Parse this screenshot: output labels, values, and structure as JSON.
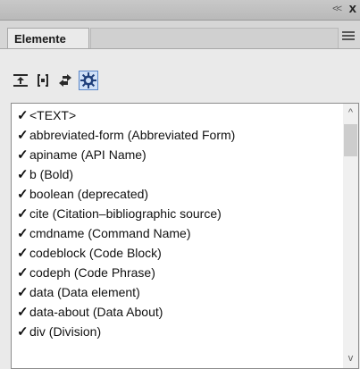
{
  "window": {
    "collapse_glyph": "<<",
    "close_glyph": "x"
  },
  "tabs": [
    {
      "label": "Elemente"
    }
  ],
  "toolbar": {
    "tools": [
      {
        "icon": "insert-element-icon",
        "active": false
      },
      {
        "icon": "wrap-element-icon",
        "active": false
      },
      {
        "icon": "change-element-icon",
        "active": false
      },
      {
        "icon": "gear-icon",
        "active": true
      }
    ]
  },
  "elements": {
    "check_glyph": "✓",
    "items": [
      "<TEXT>",
      "abbreviated-form  (Abbreviated Form)",
      "apiname  (API Name)",
      "b  (Bold)",
      "boolean  (deprecated)",
      "cite  (Citation–bibliographic source)",
      "cmdname  (Command Name)",
      "codeblock  (Code Block)",
      "codeph  (Code Phrase)",
      "data  (Data element)",
      "data-about  (Data About)",
      "div  (Division)"
    ]
  },
  "scrollbar": {
    "up_glyph": "^",
    "down_glyph": "v"
  },
  "colors": {
    "accent": "#5a86c8"
  }
}
